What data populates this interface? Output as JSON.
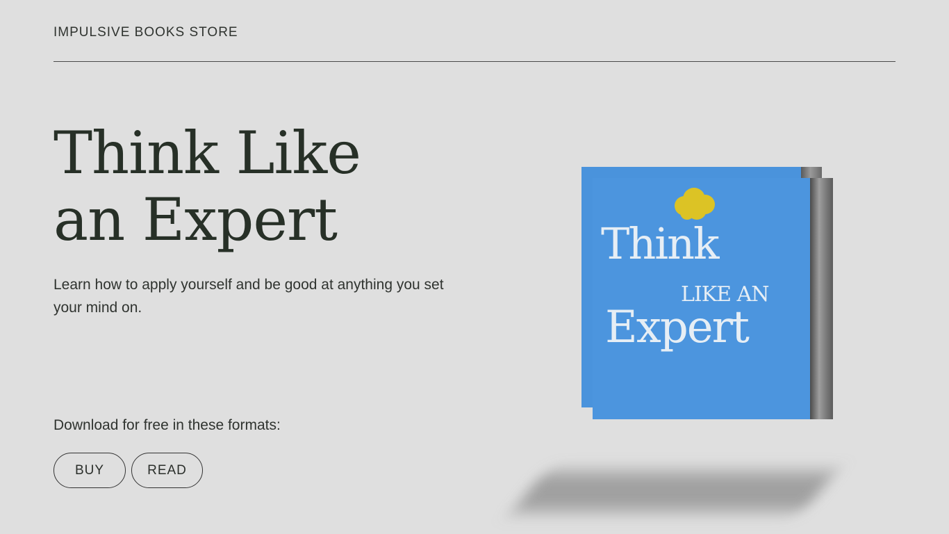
{
  "header": {
    "store_name": "IMPULSIVE BOOKS STORE"
  },
  "hero": {
    "title_line1": "Think Like",
    "title_line2": "an Expert",
    "subtitle": "Learn how to apply yourself and be good at anything you set your mind on.",
    "formats_label": "Download for free in these formats:",
    "buttons": {
      "buy": "BUY",
      "read": "READ"
    }
  },
  "book": {
    "cover_think": "Think",
    "cover_like": "LIKE AN",
    "cover_expert": "Expert",
    "cover_color": "#4c95de",
    "accent_color": "#dcc325",
    "icon": "cloud-icon"
  }
}
